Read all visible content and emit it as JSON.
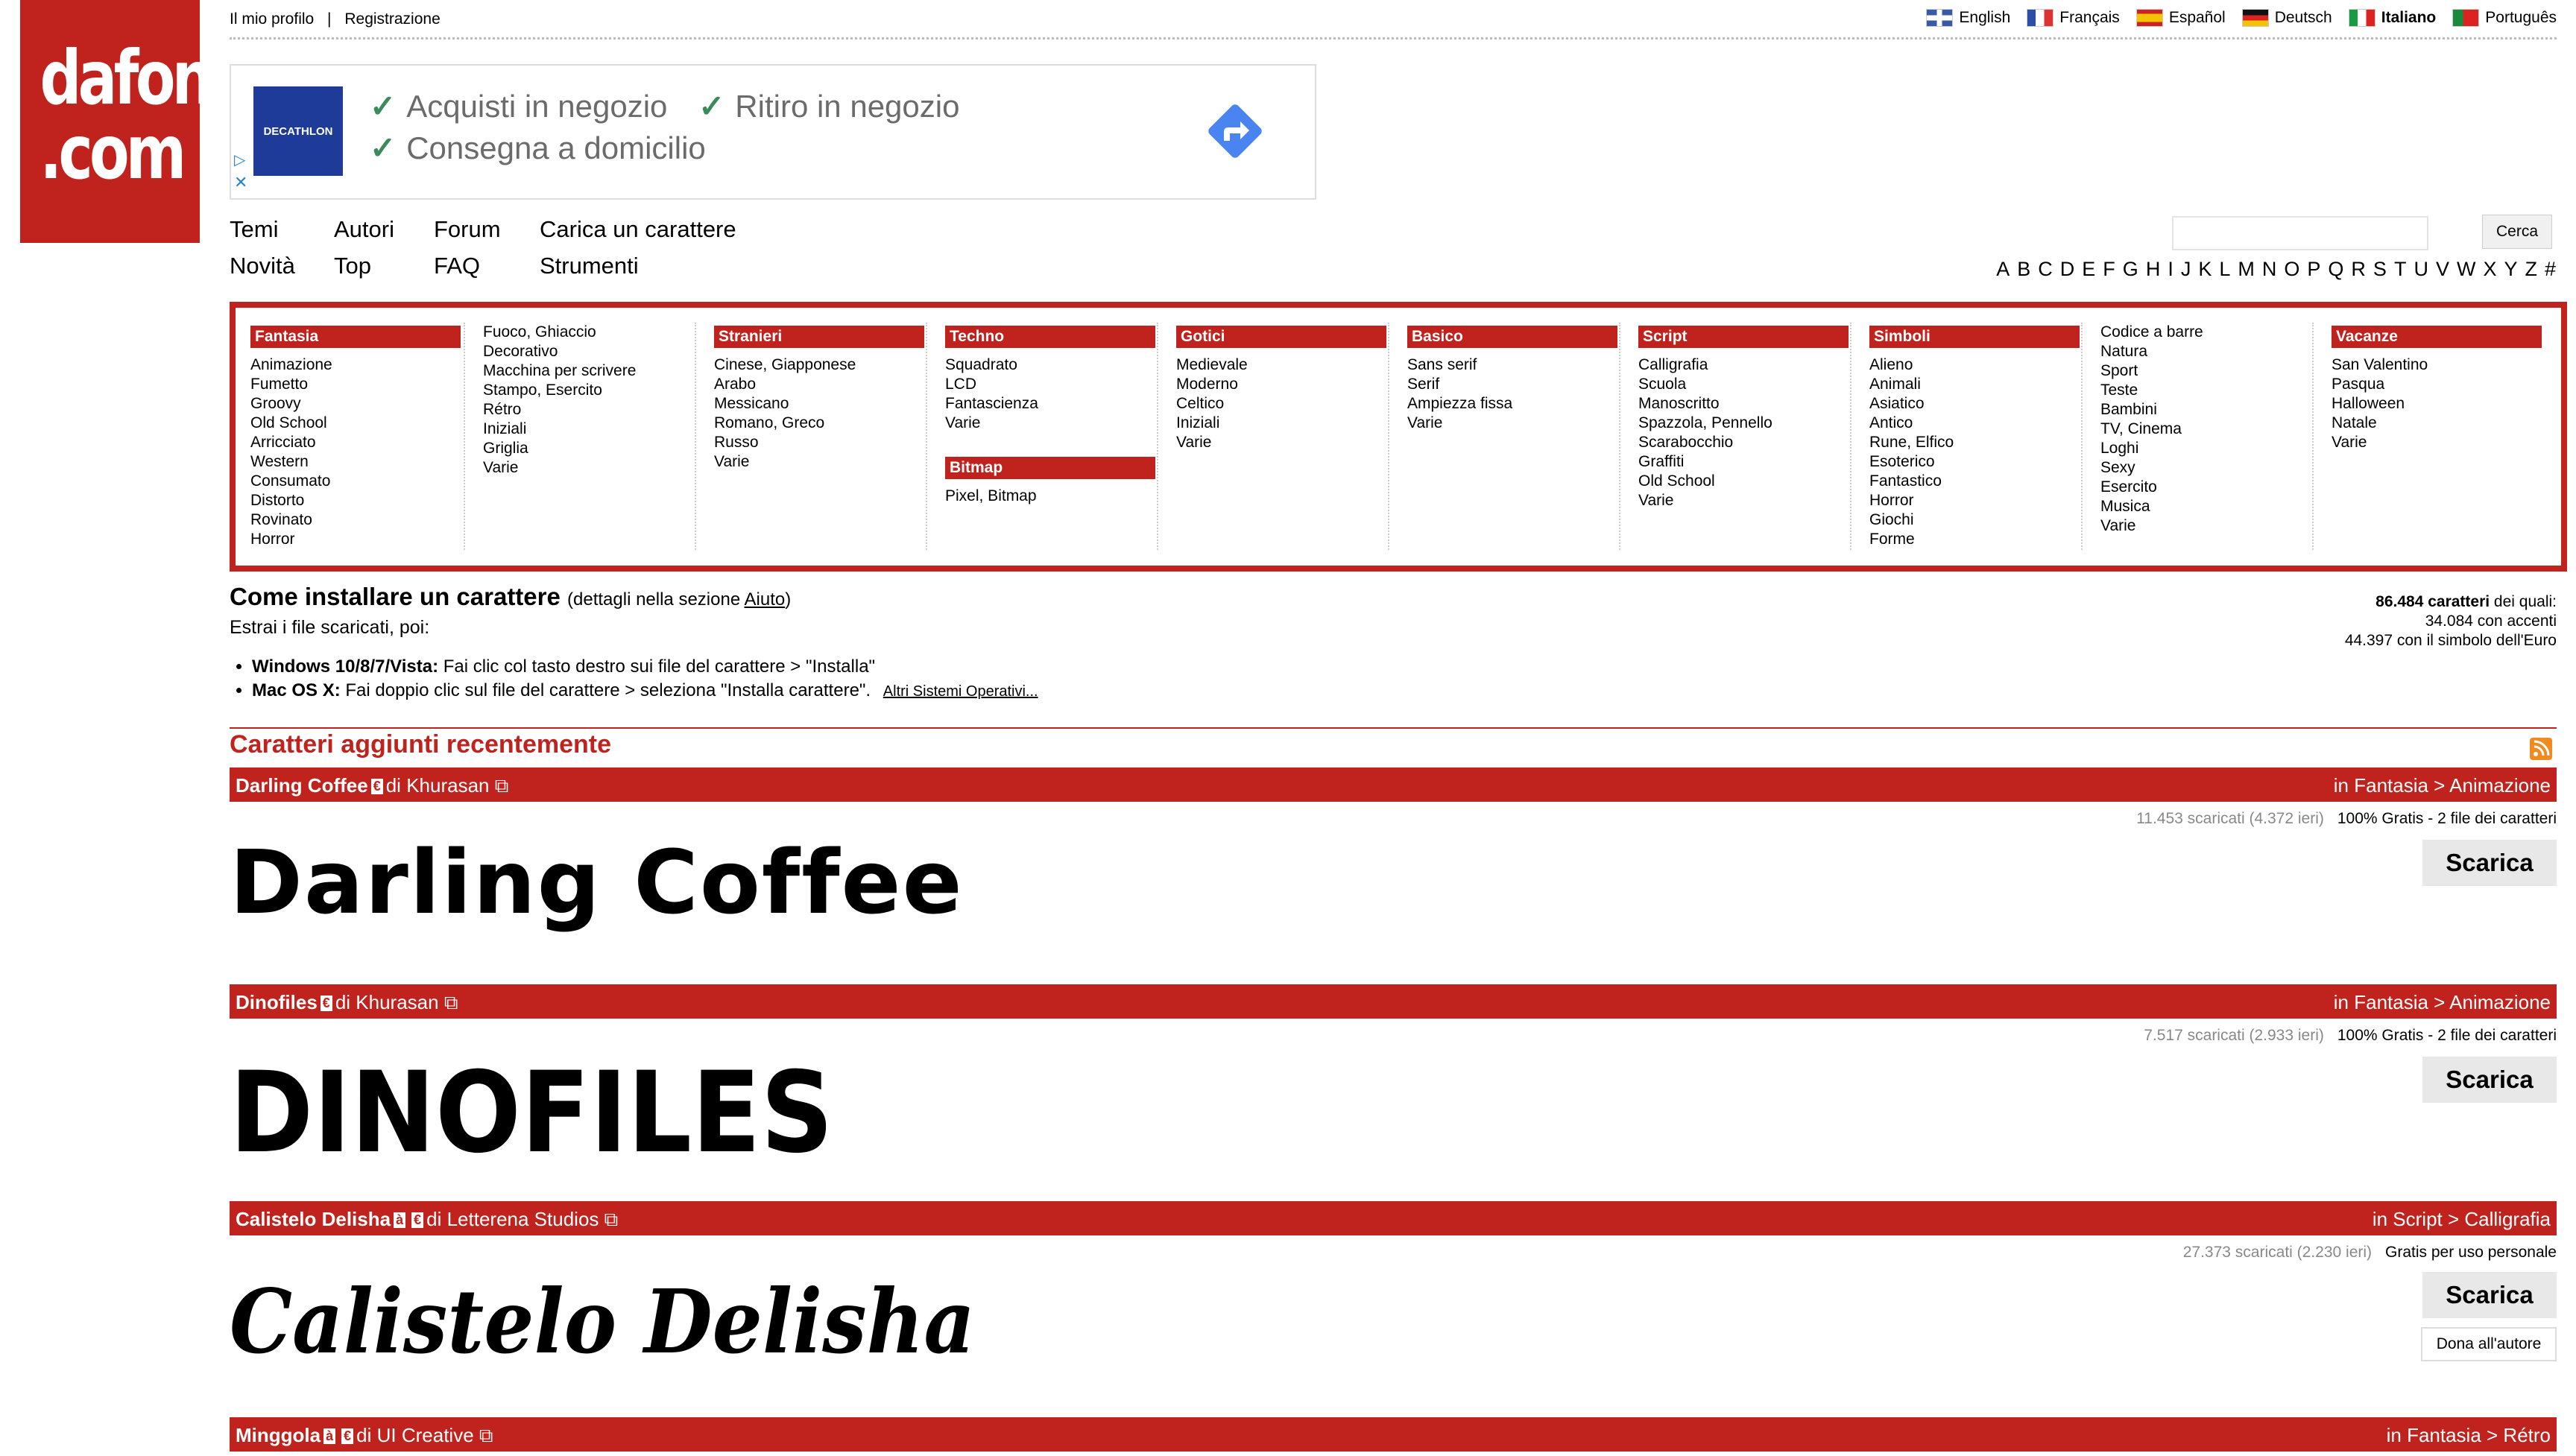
{
  "logo": {
    "line1": "dafont",
    "line2": ".com"
  },
  "topbar": {
    "profile": "Il mio profilo",
    "separator": "|",
    "register": "Registrazione",
    "languages": [
      {
        "label": "English",
        "active": false
      },
      {
        "label": "Français",
        "active": false
      },
      {
        "label": "Español",
        "active": false
      },
      {
        "label": "Deutsch",
        "active": false
      },
      {
        "label": "Italiano",
        "active": true
      },
      {
        "label": "Português",
        "active": false
      }
    ]
  },
  "ad": {
    "brand": "DECATHLON",
    "line1a": "Acquisti in negozio",
    "line1b": "Ritiro in negozio",
    "line2": "Consegna a domicilio"
  },
  "nav": {
    "row1": [
      "Temi",
      "Autori",
      "Forum",
      "Carica un carattere"
    ],
    "row2": [
      "Novità",
      "Top",
      "FAQ",
      "Strumenti"
    ]
  },
  "search": {
    "button": "Cerca",
    "value": ""
  },
  "alphabet": [
    "A",
    "B",
    "C",
    "D",
    "E",
    "F",
    "G",
    "H",
    "I",
    "J",
    "K",
    "L",
    "M",
    "N",
    "O",
    "P",
    "Q",
    "R",
    "S",
    "T",
    "U",
    "V",
    "W",
    "X",
    "Y",
    "Z",
    "#"
  ],
  "categories": {
    "fantasia": {
      "title": "Fantasia",
      "items": [
        "Animazione",
        "Fumetto",
        "Groovy",
        "Old School",
        "Arricciato",
        "Western",
        "Consumato",
        "Distorto",
        "Rovinato",
        "Horror"
      ]
    },
    "fantasia2": {
      "items": [
        "Fuoco, Ghiaccio",
        "Decorativo",
        "Macchina per scrivere",
        "Stampo, Esercito",
        "Rétro",
        "Iniziali",
        "Griglia",
        "Varie"
      ]
    },
    "stranieri": {
      "title": "Stranieri",
      "items": [
        "Cinese, Giapponese",
        "Arabo",
        "Messicano",
        "Romano, Greco",
        "Russo",
        "Varie"
      ]
    },
    "techno": {
      "title": "Techno",
      "items": [
        "Squadrato",
        "LCD",
        "Fantascienza",
        "Varie"
      ]
    },
    "bitmap": {
      "title": "Bitmap",
      "items": [
        "Pixel, Bitmap"
      ]
    },
    "gotici": {
      "title": "Gotici",
      "items": [
        "Medievale",
        "Moderno",
        "Celtico",
        "Iniziali",
        "Varie"
      ]
    },
    "basico": {
      "title": "Basico",
      "items": [
        "Sans serif",
        "Serif",
        "Ampiezza fissa",
        "Varie"
      ]
    },
    "script": {
      "title": "Script",
      "items": [
        "Calligrafia",
        "Scuola",
        "Manoscritto",
        "Spazzola, Pennello",
        "Scarabocchio",
        "Graffiti",
        "Old School",
        "Varie"
      ]
    },
    "simboli": {
      "title": "Simboli",
      "items": [
        "Alieno",
        "Animali",
        "Asiatico",
        "Antico",
        "Rune, Elfico",
        "Esoterico",
        "Fantastico",
        "Horror",
        "Giochi",
        "Forme"
      ]
    },
    "simboli2": {
      "items": [
        "Codice a barre",
        "Natura",
        "Sport",
        "Teste",
        "Bambini",
        "TV, Cinema",
        "Loghi",
        "Sexy",
        "Esercito",
        "Musica",
        "Varie"
      ]
    },
    "vacanze": {
      "title": "Vacanze",
      "items": [
        "San Valentino",
        "Pasqua",
        "Halloween",
        "Natale",
        "Varie"
      ]
    }
  },
  "install": {
    "title": "Come installare un carattere",
    "details_pre": "(dettagli nella sezione ",
    "details_link": "Aiuto",
    "details_post": ")",
    "intro": "Estrai i file scaricati, poi:",
    "win_label": "Windows 10/8/7/Vista:",
    "win_text": " Fai clic col tasto destro sui file del carattere > \"Installa\"",
    "mac_label": "Mac OS X:",
    "mac_text": " Fai doppio clic sul file del carattere > seleziona \"Installa carattere\".",
    "other": "Altri Sistemi Operativi..."
  },
  "stats": {
    "total": "86.484 caratteri",
    "total_suffix": " dei quali:",
    "accents": "34.084 con accenti",
    "euro": "44.397 con il simbolo dell'Euro"
  },
  "recent": {
    "title": "Caratteri aggiunti recentemente"
  },
  "fonts": [
    {
      "name": "Darling Coffee",
      "badges": [
        "€"
      ],
      "by": "di",
      "author": "Khurasan",
      "category": "in Fantasia > Animazione",
      "downloads": "11.453 scaricati (4.372 ieri)",
      "license": "100% Gratis - 2 file dei caratteri",
      "download": "Scarica",
      "preview": "Darling Coffee"
    },
    {
      "name": "Dinofiles",
      "badges": [
        "€"
      ],
      "by": "di",
      "author": "Khurasan",
      "category": "in Fantasia > Animazione",
      "downloads": "7.517 scaricati (2.933 ieri)",
      "license": "100% Gratis - 2 file dei caratteri",
      "download": "Scarica",
      "preview": "DINOFILES"
    },
    {
      "name": "Calistelo Delisha",
      "badges": [
        "à",
        "€"
      ],
      "by": "di",
      "author": "Letterena Studios",
      "category": "in Script > Calligrafia",
      "downloads": "27.373 scaricati (2.230 ieri)",
      "license": "Gratis per uso personale",
      "download": "Scarica",
      "donate": "Dona all'autore",
      "preview": "Calistelo Delisha"
    },
    {
      "name": "Minggola",
      "badges": [
        "à",
        "€"
      ],
      "by": "di",
      "author": "UI Creative",
      "category": "in Fantasia > Rétro"
    }
  ],
  "colors": {
    "brand": "#c0231d"
  }
}
